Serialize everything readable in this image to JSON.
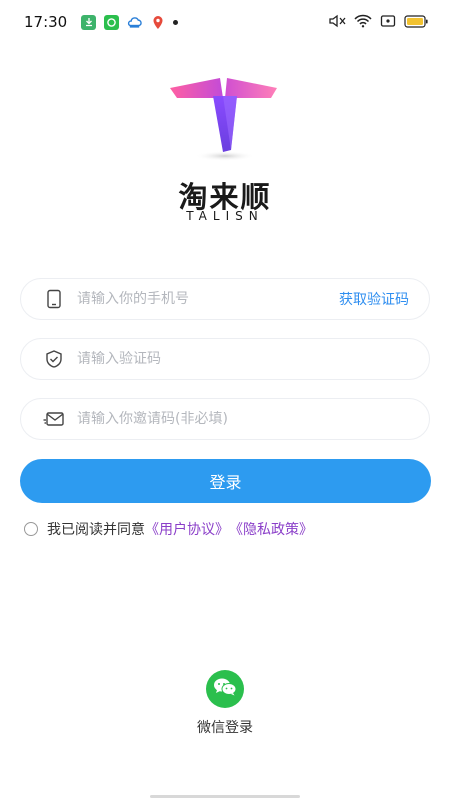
{
  "status_bar": {
    "time": "17:30",
    "notification_icons": [
      "download-icon",
      "chat-icon",
      "cloud-icon",
      "map-pin-icon"
    ],
    "system_icons": [
      "mute-icon",
      "wifi-icon",
      "screen-icon",
      "battery-icon"
    ],
    "battery_color": "#f2c230"
  },
  "brand": {
    "name": "淘来顺",
    "name_en": "TALISN",
    "logo_colors": [
      "#ff5fa2",
      "#7b4dff"
    ]
  },
  "form": {
    "phone_placeholder": "请输入你的手机号",
    "get_code_label": "获取验证码",
    "code_placeholder": "请输入验证码",
    "invite_placeholder": "请输入你邀请码(非必填)"
  },
  "login": {
    "label": "登录",
    "color": "#2d9bf0"
  },
  "agreement": {
    "prefix": "我已阅读并同意",
    "user_agreement": "《用户协议》",
    "privacy_policy": "《隐私政策》",
    "checked": false
  },
  "wechat": {
    "label": "微信登录",
    "color": "#2bbf4d"
  }
}
